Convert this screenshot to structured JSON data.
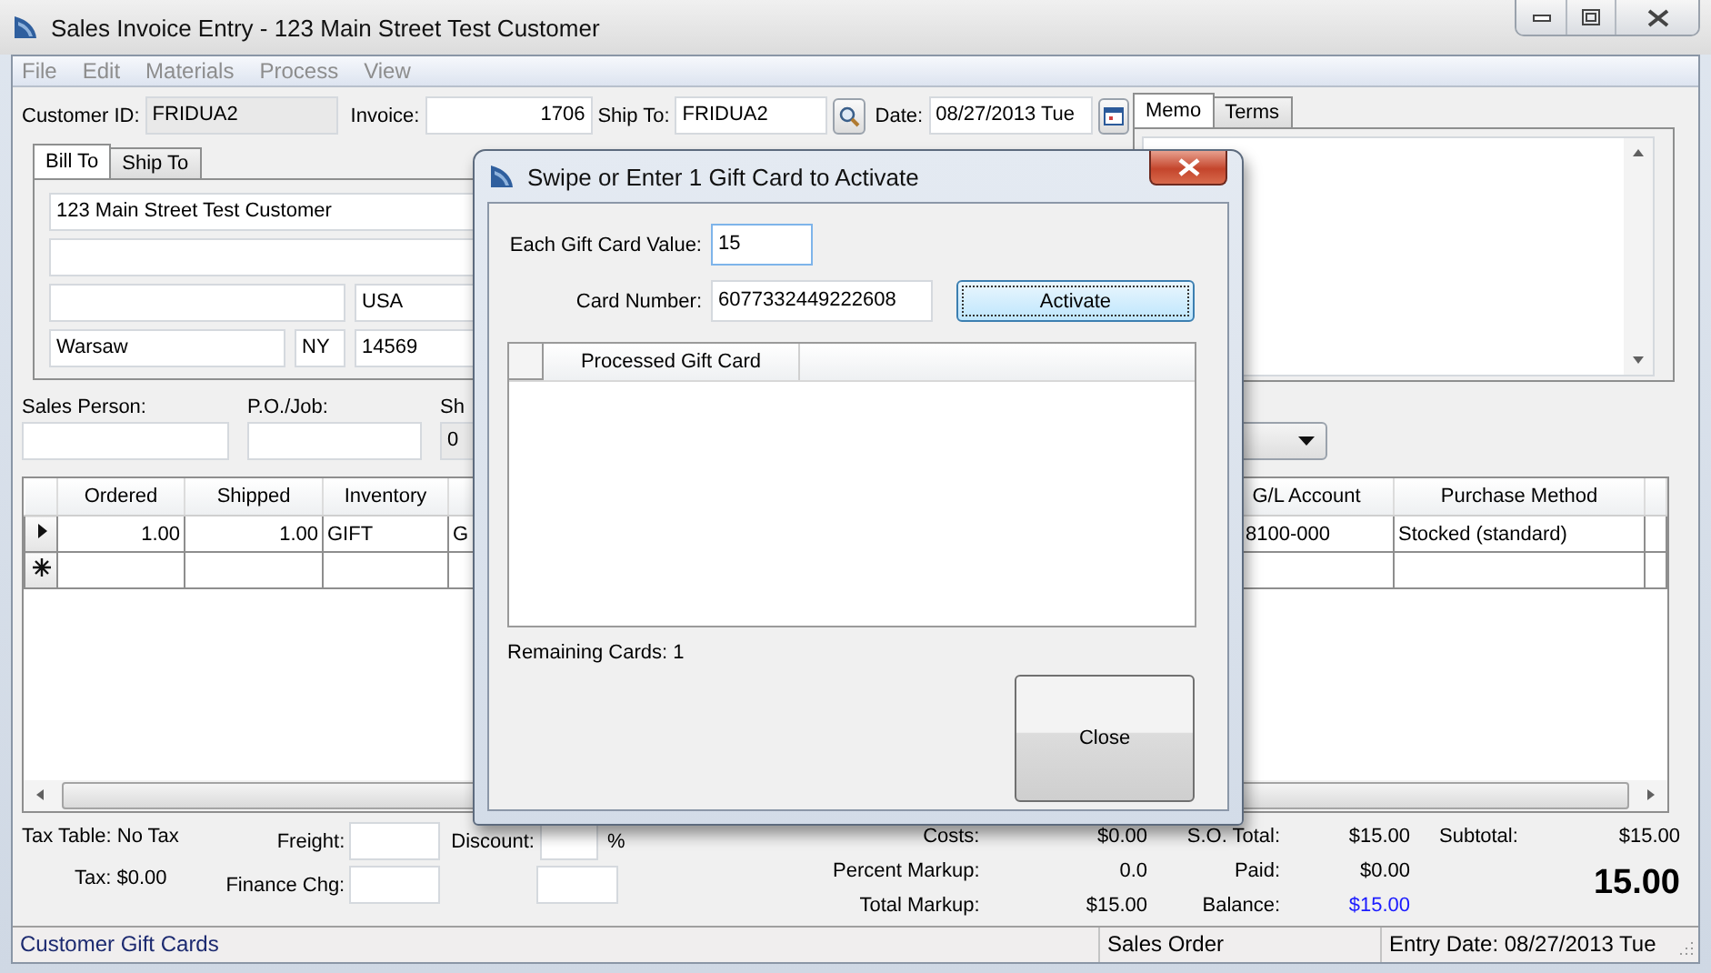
{
  "window": {
    "title": "Sales Invoice Entry - 123 Main Street Test Customer"
  },
  "menu": [
    {
      "label": "File",
      "disabled": true
    },
    {
      "label": "Edit",
      "disabled": true
    },
    {
      "label": "Materials",
      "disabled": true
    },
    {
      "label": "Process",
      "disabled": true
    },
    {
      "label": "View",
      "disabled": true
    }
  ],
  "header": {
    "customer_id": {
      "label": "Customer ID:",
      "value": "FRIDUA2"
    },
    "invoice": {
      "label": "Invoice:",
      "value": "1706"
    },
    "ship_to": {
      "label": "Ship To:",
      "value": "FRIDUA2"
    },
    "date": {
      "label": "Date:",
      "value": "08/27/2013 Tue"
    }
  },
  "address_tabs": [
    {
      "label": "Bill To",
      "selected": true
    },
    {
      "label": "Ship To",
      "selected": false
    }
  ],
  "address": {
    "line_1": "123 Main Street Test Customer",
    "country": "USA",
    "city": "Warsaw",
    "state": "NY",
    "zip": "14569"
  },
  "order_fields": [
    {
      "label": "Sales Person:"
    },
    {
      "label": "P.O./Job:"
    },
    {
      "label": "Sh",
      "value": "0"
    }
  ],
  "memo_tabs": [
    {
      "label": "Memo",
      "selected": true
    },
    {
      "label": "Terms",
      "selected": false
    }
  ],
  "lines": {
    "columns": [
      {
        "label": "Ordered"
      },
      {
        "label": "Shipped"
      },
      {
        "label": "Inventory"
      },
      {},
      {
        "label": "G/L Account"
      },
      {
        "label": "Purchase Method"
      }
    ],
    "rows": [
      {
        "kind": "current",
        "cells": [
          "1.00",
          "1.00",
          "GIFT",
          "G",
          "8100-000",
          "Stocked (standard)"
        ]
      },
      {
        "kind": "new"
      }
    ]
  },
  "tax": {
    "table": "Tax Table: No Tax",
    "amount": "Tax: $0.00"
  },
  "charges": {
    "freight": "Freight:",
    "finance": "Finance Chg:",
    "discount": "Discount:",
    "percent": "%"
  },
  "markup": [
    {
      "label": "Costs:",
      "value": "$0.00"
    },
    {
      "label": "Percent Markup:",
      "value": "0.0"
    },
    {
      "label": "Total Markup:",
      "value": "$15.00"
    }
  ],
  "balances": [
    {
      "label": "S.O. Total:",
      "value": "$15.00",
      "highlight": false
    },
    {
      "label": "Paid:",
      "value": "$0.00",
      "highlight": false
    },
    {
      "label": "Balance:",
      "value": "$15.00",
      "highlight": true
    }
  ],
  "subtotal": {
    "label": "Subtotal:",
    "value": "$15.00",
    "total": "15.00"
  },
  "status_bar": [
    "Customer Gift Cards",
    "Sales Order",
    "Entry Date: 08/27/2013 Tue"
  ],
  "dialog": {
    "title": "Swipe or Enter 1 Gift Card to Activate",
    "value_field": {
      "label": "Each Gift Card Value:",
      "value": "15"
    },
    "card_field": {
      "label": "Card Number:",
      "value": "6077332449222608"
    },
    "activate": {
      "label": "Activate",
      "focused": true
    },
    "grid_column": "Processed Gift Card",
    "remaining": "Remaining Cards: 1",
    "close": "Close"
  }
}
